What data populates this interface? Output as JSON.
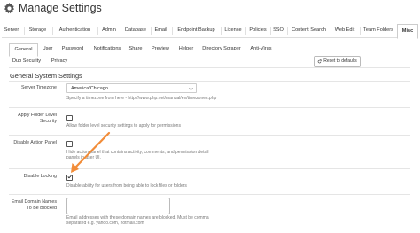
{
  "header": {
    "title": "Manage Settings",
    "icon": "gear-icon"
  },
  "main_tabs": [
    "Server",
    "Storage",
    "Authentication",
    "Admin",
    "Database",
    "Email",
    "Endpoint Backup",
    "License",
    "Policies",
    "SSO",
    "Content Search",
    "Web Edit",
    "Team Folders",
    "Misc"
  ],
  "main_tabs_active": "Misc",
  "sub_tabs": [
    "General",
    "User",
    "Password",
    "Notifications",
    "Share",
    "Preview",
    "Helper",
    "Directory Scraper",
    "Anti-Virus",
    "Duo Security",
    "Privacy"
  ],
  "sub_tabs_active": "General",
  "reset_button": "Reset to defaults",
  "section_title": "General System Settings",
  "settings": {
    "timezone": {
      "label": "Server Timezone",
      "value": "America/Chicago",
      "help": "Specify a timezone from here - http://www.php.net/manual/en/timezones.php"
    },
    "folder_security": {
      "label_1": "Apply Folder Level",
      "label_2": "Security",
      "checked": false,
      "help": "Allow folder level security settings to apply for permissions"
    },
    "action_panel": {
      "label": "Disable Action Panel",
      "checked": false,
      "help_1": "Hide action panel that contains activity, comments, and permission detail",
      "help_2": "panels in user UI."
    },
    "locking": {
      "label": "Disable Locking",
      "checked": true,
      "help": "Disable ability for users from being able to lock files or folders"
    },
    "domains": {
      "label_1": "Email Domain Names",
      "label_2": "To Be Blocked",
      "help_1": "Email addresses with these domain names are blocked. Must be comma",
      "help_2": "separated e.g. yahoo.com, hotmail.com"
    }
  },
  "colors": {
    "arrow": "#f28c38",
    "text": "#333333",
    "help": "#777777"
  }
}
